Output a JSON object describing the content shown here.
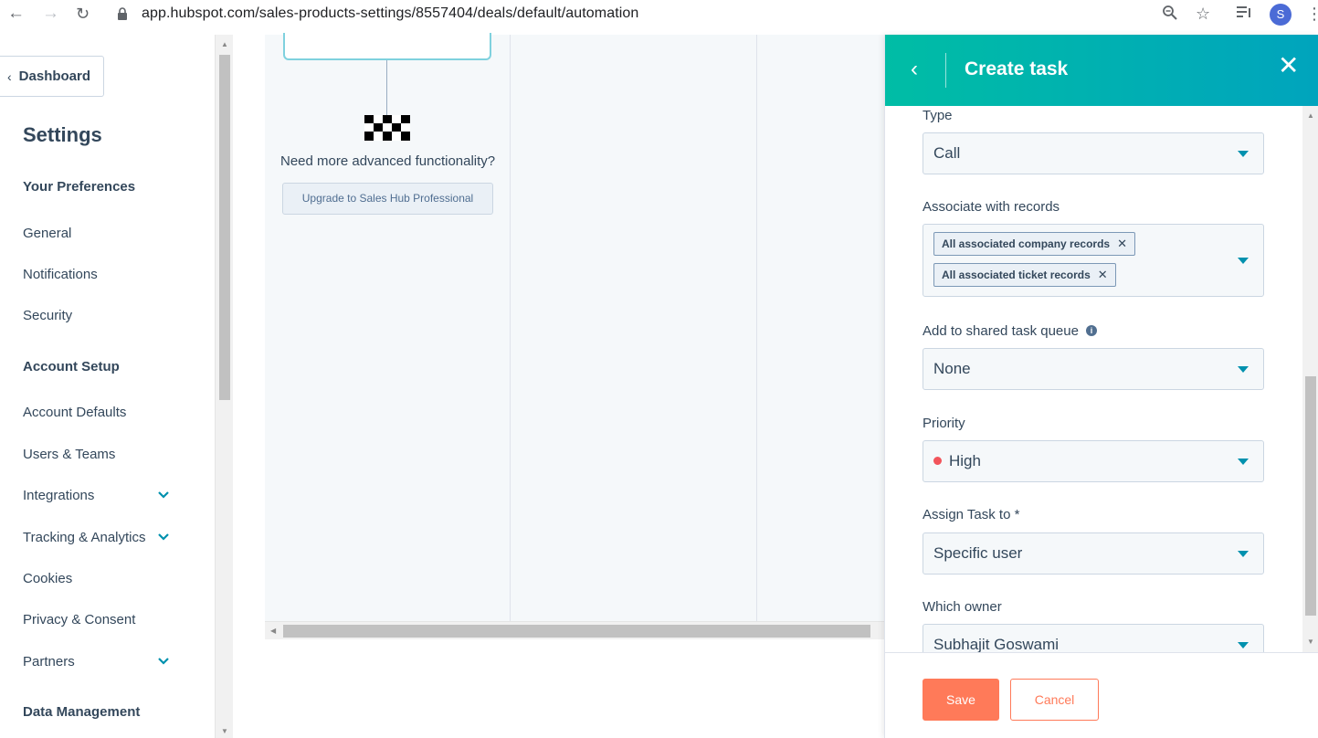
{
  "browser": {
    "url": "app.hubspot.com/sales-products-settings/8557404/deals/default/automation",
    "profile_initial": "S",
    "icons": [
      "back-arrow-icon",
      "forward-arrow-icon",
      "reload-icon",
      "lock-icon",
      "zoom-icon",
      "star-icon",
      "media-queue-icon",
      "menu-icon"
    ]
  },
  "sidebar": {
    "dashboard_label": "Dashboard",
    "title": "Settings",
    "items": [
      {
        "label": "Your Preferences",
        "head": true
      },
      {
        "label": "General"
      },
      {
        "label": "Notifications"
      },
      {
        "label": "Security"
      },
      {
        "label": "Account Setup",
        "head": true
      },
      {
        "label": "Account Defaults"
      },
      {
        "label": "Users & Teams"
      },
      {
        "label": "Integrations",
        "expandable": true
      },
      {
        "label": "Tracking & Analytics",
        "expandable": true
      },
      {
        "label": "Cookies"
      },
      {
        "label": "Privacy & Consent"
      },
      {
        "label": "Partners",
        "expandable": true
      },
      {
        "label": "Data Management",
        "head": true
      }
    ]
  },
  "canvas": {
    "advanced_text": "Need more advanced functionality?",
    "upgrade_label": "Upgrade to Sales Hub Professional"
  },
  "panel": {
    "title": "Create task",
    "fields": {
      "type": {
        "label": "Type",
        "value": "Call"
      },
      "associate": {
        "label": "Associate with records",
        "tags": [
          "All associated company records",
          "All associated ticket records"
        ]
      },
      "queue": {
        "label": "Add to shared task queue",
        "value": "None"
      },
      "priority": {
        "label": "Priority",
        "value": "High",
        "color": "#f2545b"
      },
      "assign": {
        "label": "Assign Task to *",
        "value": "Specific user"
      },
      "owner": {
        "label": "Which owner",
        "value": "Subhajit Goswami"
      }
    },
    "save_label": "Save",
    "cancel_label": "Cancel"
  },
  "colors": {
    "header_gradient_start": "#00bda5",
    "header_gradient_end": "#00a4bd",
    "primary_button": "#ff7a59",
    "accent": "#0091ae"
  }
}
